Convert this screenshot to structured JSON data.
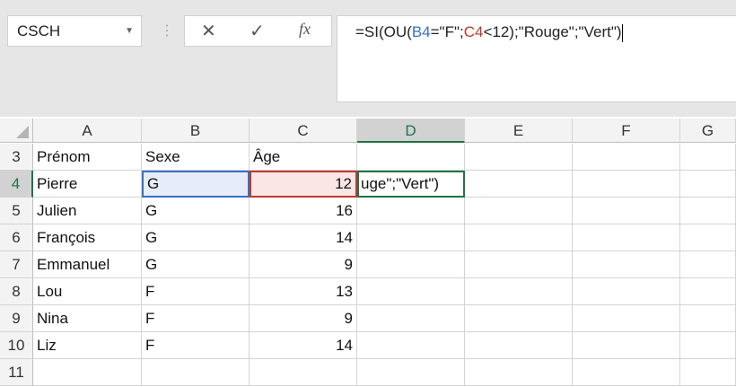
{
  "name_box": {
    "value": "CSCH"
  },
  "formula_bar": {
    "prefix": "=SI(OU(",
    "ref1": "B4",
    "mid1": "=\"F\";",
    "ref2": "C4",
    "suffix": "<12);\"Rouge\";\"Vert\")",
    "cancel_icon": "✕",
    "enter_icon": "✓",
    "fx_icon": "fx"
  },
  "columns": [
    "A",
    "B",
    "C",
    "D",
    "E",
    "F",
    "G"
  ],
  "rows": [
    {
      "num": "3",
      "a": "Prénom",
      "b": "Sexe",
      "c": "Âge",
      "d": ""
    },
    {
      "num": "4",
      "a": "Pierre",
      "b": "G",
      "c": "12",
      "d": "uge\";\"Vert\")"
    },
    {
      "num": "5",
      "a": "Julien",
      "b": "G",
      "c": "16",
      "d": ""
    },
    {
      "num": "6",
      "a": "François",
      "b": "G",
      "c": "14",
      "d": ""
    },
    {
      "num": "7",
      "a": "Emmanuel",
      "b": "G",
      "c": "9",
      "d": ""
    },
    {
      "num": "8",
      "a": "Lou",
      "b": "F",
      "c": "13",
      "d": ""
    },
    {
      "num": "9",
      "a": "Nina",
      "b": "F",
      "c": "9",
      "d": ""
    },
    {
      "num": "10",
      "a": "Liz",
      "b": "F",
      "c": "14",
      "d": ""
    },
    {
      "num": "11",
      "a": "",
      "b": "",
      "c": "",
      "d": ""
    }
  ],
  "colors": {
    "ref_blue": "#3a6fc4",
    "ref_red": "#c0392b",
    "active_green": "#217346"
  }
}
